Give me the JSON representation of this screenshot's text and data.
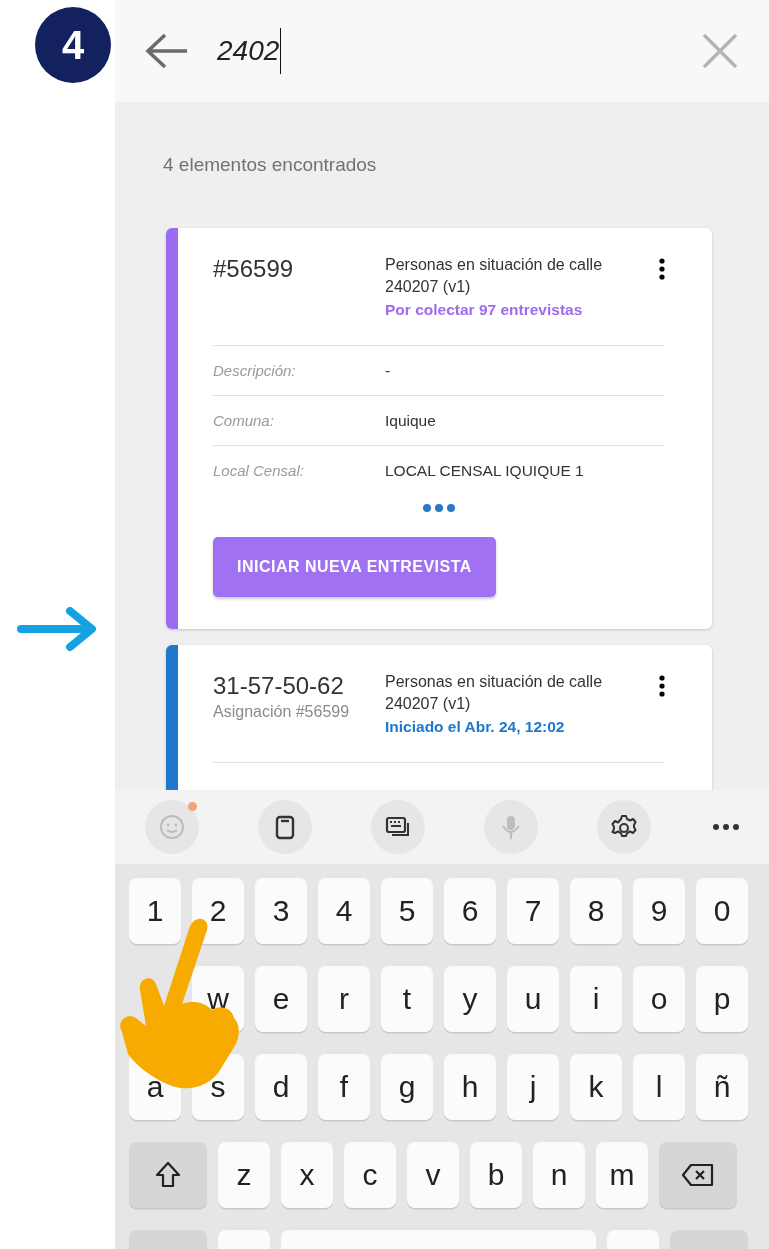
{
  "step_badge": {
    "text": "4"
  },
  "search": {
    "value": "2402"
  },
  "results_count": "4 elementos encontrados",
  "cards": [
    {
      "kind": "assignment",
      "color": "#9c6cf0",
      "id": "#56599",
      "title": "Personas en situación de calle 240207 (v1)",
      "status": "Por colectar 97 entrevistas",
      "fields": [
        {
          "label": "Descripción:",
          "value": "-"
        },
        {
          "label": "Comuna:",
          "value": "Iquique"
        },
        {
          "label": "Local Censal:",
          "value": "LOCAL CENSAL IQUIQUE 1"
        }
      ],
      "action": "INICIAR NUEVA ENTREVISTA"
    },
    {
      "kind": "interview",
      "color": "#1e78cc",
      "id": "31-57-50-62",
      "subtitle": "Asignación #56599",
      "title": "Personas en situación de calle 240207 (v1)",
      "status": "Iniciado el Abr. 24, 12:02"
    }
  ],
  "keyboard": {
    "toolbar": [
      {
        "kind": "emoji",
        "disabled": true,
        "notification": true
      },
      {
        "kind": "clipboard",
        "disabled": false,
        "notification": false
      },
      {
        "kind": "keyboard",
        "disabled": false,
        "notification": false
      },
      {
        "kind": "mic",
        "disabled": true,
        "notification": false
      },
      {
        "kind": "settings",
        "disabled": false,
        "notification": false
      },
      {
        "kind": "more",
        "disabled": false,
        "notification": false
      }
    ],
    "rows": [
      [
        {
          "kind": "letter",
          "label": "1"
        },
        {
          "kind": "letter",
          "label": "2"
        },
        {
          "kind": "letter",
          "label": "3"
        },
        {
          "kind": "letter",
          "label": "4"
        },
        {
          "kind": "letter",
          "label": "5"
        },
        {
          "kind": "letter",
          "label": "6"
        },
        {
          "kind": "letter",
          "label": "7"
        },
        {
          "kind": "letter",
          "label": "8"
        },
        {
          "kind": "letter",
          "label": "9"
        },
        {
          "kind": "letter",
          "label": "0"
        }
      ],
      [
        {
          "kind": "covered"
        },
        {
          "kind": "letter",
          "label": "w"
        },
        {
          "kind": "letter",
          "label": "e"
        },
        {
          "kind": "letter",
          "label": "r"
        },
        {
          "kind": "letter",
          "label": "t"
        },
        {
          "kind": "letter",
          "label": "y"
        },
        {
          "kind": "letter",
          "label": "u"
        },
        {
          "kind": "letter",
          "label": "i"
        },
        {
          "kind": "letter",
          "label": "o"
        },
        {
          "kind": "letter",
          "label": "p"
        }
      ],
      [
        {
          "kind": "letter",
          "label": "a"
        },
        {
          "kind": "letter",
          "label": "s"
        },
        {
          "kind": "letter",
          "label": "d"
        },
        {
          "kind": "letter",
          "label": "f"
        },
        {
          "kind": "letter",
          "label": "g"
        },
        {
          "kind": "letter",
          "label": "h"
        },
        {
          "kind": "letter",
          "label": "j"
        },
        {
          "kind": "letter",
          "label": "k"
        },
        {
          "kind": "letter",
          "label": "l"
        },
        {
          "kind": "letter",
          "label": "ñ"
        }
      ],
      [
        {
          "kind": "shift"
        },
        {
          "kind": "letter",
          "label": "z"
        },
        {
          "kind": "letter",
          "label": "x"
        },
        {
          "kind": "letter",
          "label": "c"
        },
        {
          "kind": "letter",
          "label": "v"
        },
        {
          "kind": "letter",
          "label": "b"
        },
        {
          "kind": "letter",
          "label": "n"
        },
        {
          "kind": "letter",
          "label": "m"
        },
        {
          "kind": "backspace"
        }
      ],
      [
        {
          "kind": "gray"
        },
        {
          "kind": "plain"
        },
        {
          "kind": "space"
        },
        {
          "kind": "plain"
        },
        {
          "kind": "gray"
        }
      ]
    ]
  }
}
